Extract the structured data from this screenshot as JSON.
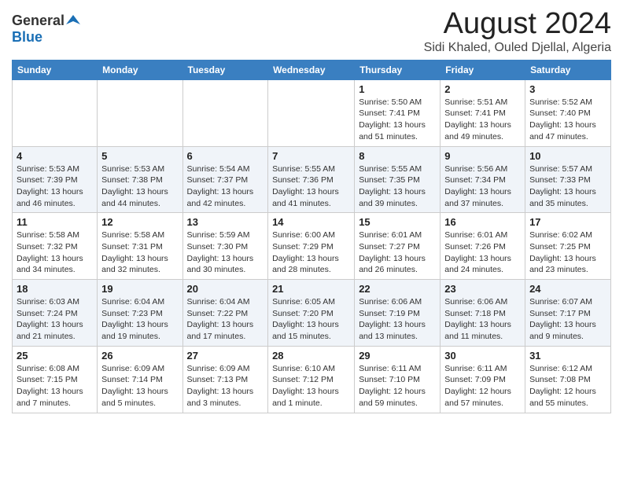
{
  "logo": {
    "general": "General",
    "blue": "Blue"
  },
  "title": "August 2024",
  "subtitle": "Sidi Khaled, Ouled Djellal, Algeria",
  "days_of_week": [
    "Sunday",
    "Monday",
    "Tuesday",
    "Wednesday",
    "Thursday",
    "Friday",
    "Saturday"
  ],
  "weeks": [
    [
      {
        "day": "",
        "info": ""
      },
      {
        "day": "",
        "info": ""
      },
      {
        "day": "",
        "info": ""
      },
      {
        "day": "",
        "info": ""
      },
      {
        "day": "1",
        "info": "Sunrise: 5:50 AM\nSunset: 7:41 PM\nDaylight: 13 hours and 51 minutes."
      },
      {
        "day": "2",
        "info": "Sunrise: 5:51 AM\nSunset: 7:41 PM\nDaylight: 13 hours and 49 minutes."
      },
      {
        "day": "3",
        "info": "Sunrise: 5:52 AM\nSunset: 7:40 PM\nDaylight: 13 hours and 47 minutes."
      }
    ],
    [
      {
        "day": "4",
        "info": "Sunrise: 5:53 AM\nSunset: 7:39 PM\nDaylight: 13 hours and 46 minutes."
      },
      {
        "day": "5",
        "info": "Sunrise: 5:53 AM\nSunset: 7:38 PM\nDaylight: 13 hours and 44 minutes."
      },
      {
        "day": "6",
        "info": "Sunrise: 5:54 AM\nSunset: 7:37 PM\nDaylight: 13 hours and 42 minutes."
      },
      {
        "day": "7",
        "info": "Sunrise: 5:55 AM\nSunset: 7:36 PM\nDaylight: 13 hours and 41 minutes."
      },
      {
        "day": "8",
        "info": "Sunrise: 5:55 AM\nSunset: 7:35 PM\nDaylight: 13 hours and 39 minutes."
      },
      {
        "day": "9",
        "info": "Sunrise: 5:56 AM\nSunset: 7:34 PM\nDaylight: 13 hours and 37 minutes."
      },
      {
        "day": "10",
        "info": "Sunrise: 5:57 AM\nSunset: 7:33 PM\nDaylight: 13 hours and 35 minutes."
      }
    ],
    [
      {
        "day": "11",
        "info": "Sunrise: 5:58 AM\nSunset: 7:32 PM\nDaylight: 13 hours and 34 minutes."
      },
      {
        "day": "12",
        "info": "Sunrise: 5:58 AM\nSunset: 7:31 PM\nDaylight: 13 hours and 32 minutes."
      },
      {
        "day": "13",
        "info": "Sunrise: 5:59 AM\nSunset: 7:30 PM\nDaylight: 13 hours and 30 minutes."
      },
      {
        "day": "14",
        "info": "Sunrise: 6:00 AM\nSunset: 7:29 PM\nDaylight: 13 hours and 28 minutes."
      },
      {
        "day": "15",
        "info": "Sunrise: 6:01 AM\nSunset: 7:27 PM\nDaylight: 13 hours and 26 minutes."
      },
      {
        "day": "16",
        "info": "Sunrise: 6:01 AM\nSunset: 7:26 PM\nDaylight: 13 hours and 24 minutes."
      },
      {
        "day": "17",
        "info": "Sunrise: 6:02 AM\nSunset: 7:25 PM\nDaylight: 13 hours and 23 minutes."
      }
    ],
    [
      {
        "day": "18",
        "info": "Sunrise: 6:03 AM\nSunset: 7:24 PM\nDaylight: 13 hours and 21 minutes."
      },
      {
        "day": "19",
        "info": "Sunrise: 6:04 AM\nSunset: 7:23 PM\nDaylight: 13 hours and 19 minutes."
      },
      {
        "day": "20",
        "info": "Sunrise: 6:04 AM\nSunset: 7:22 PM\nDaylight: 13 hours and 17 minutes."
      },
      {
        "day": "21",
        "info": "Sunrise: 6:05 AM\nSunset: 7:20 PM\nDaylight: 13 hours and 15 minutes."
      },
      {
        "day": "22",
        "info": "Sunrise: 6:06 AM\nSunset: 7:19 PM\nDaylight: 13 hours and 13 minutes."
      },
      {
        "day": "23",
        "info": "Sunrise: 6:06 AM\nSunset: 7:18 PM\nDaylight: 13 hours and 11 minutes."
      },
      {
        "day": "24",
        "info": "Sunrise: 6:07 AM\nSunset: 7:17 PM\nDaylight: 13 hours and 9 minutes."
      }
    ],
    [
      {
        "day": "25",
        "info": "Sunrise: 6:08 AM\nSunset: 7:15 PM\nDaylight: 13 hours and 7 minutes."
      },
      {
        "day": "26",
        "info": "Sunrise: 6:09 AM\nSunset: 7:14 PM\nDaylight: 13 hours and 5 minutes."
      },
      {
        "day": "27",
        "info": "Sunrise: 6:09 AM\nSunset: 7:13 PM\nDaylight: 13 hours and 3 minutes."
      },
      {
        "day": "28",
        "info": "Sunrise: 6:10 AM\nSunset: 7:12 PM\nDaylight: 13 hours and 1 minute."
      },
      {
        "day": "29",
        "info": "Sunrise: 6:11 AM\nSunset: 7:10 PM\nDaylight: 12 hours and 59 minutes."
      },
      {
        "day": "30",
        "info": "Sunrise: 6:11 AM\nSunset: 7:09 PM\nDaylight: 12 hours and 57 minutes."
      },
      {
        "day": "31",
        "info": "Sunrise: 6:12 AM\nSunset: 7:08 PM\nDaylight: 12 hours and 55 minutes."
      }
    ]
  ]
}
